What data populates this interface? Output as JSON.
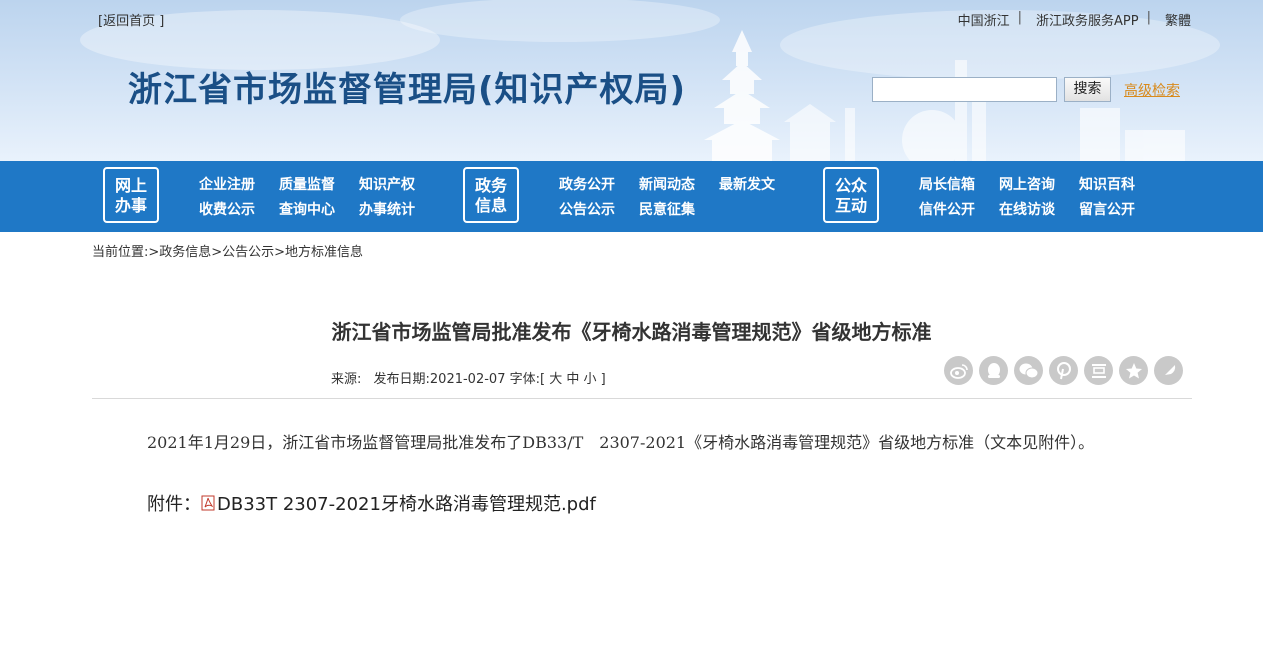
{
  "header": {
    "back_home": "[返回首页 ]",
    "top_links": [
      "中国浙江",
      "浙江政务服务APP",
      "繁體"
    ],
    "site_title": "浙江省市场监督管理局(知识产权局)",
    "search_placeholder": "",
    "search_button": "搜索",
    "advanced_search": "高级检索"
  },
  "nav": {
    "groups": [
      {
        "box": [
          "网上",
          "办事"
        ],
        "links": [
          [
            "企业注册",
            "质量监督",
            "知识产权"
          ],
          [
            "收费公示",
            "查询中心",
            "办事统计"
          ]
        ]
      },
      {
        "box": [
          "政务",
          "信息"
        ],
        "links": [
          [
            "政务公开",
            "新闻动态",
            "最新发文"
          ],
          [
            "公告公示",
            "民意征集"
          ]
        ]
      },
      {
        "box": [
          "公众",
          "互动"
        ],
        "links": [
          [
            "局长信箱",
            "网上咨询",
            "知识百科"
          ],
          [
            "信件公开",
            "在线访谈",
            "留言公开"
          ]
        ]
      }
    ]
  },
  "breadcrumb": "当前位置:>政务信息>公告公示>地方标准信息",
  "article": {
    "title": "浙江省市场监管局批准发布《牙椅水路消毒管理规范》省级地方标准",
    "source_label": "来源:",
    "date_label": "发布日期:2021-02-07",
    "font_label": "字体:[",
    "font_sizes": [
      "大",
      "中",
      "小"
    ],
    "font_close": "]",
    "share_icons": [
      "weibo-icon",
      "qzone-icon",
      "wechat-icon",
      "pinterest-icon",
      "douban-icon",
      "favorite-icon",
      "more-icon"
    ],
    "body": "2021年1月29日，浙江省市场监督管理局批准发布了DB33/T　2307-2021《牙椅水路消毒管理规范》省级地方标准（文本见附件）。",
    "attachment_label": "附件：",
    "attachment_file": "DB33T 2307-2021牙椅水路消毒管理规范.pdf"
  }
}
